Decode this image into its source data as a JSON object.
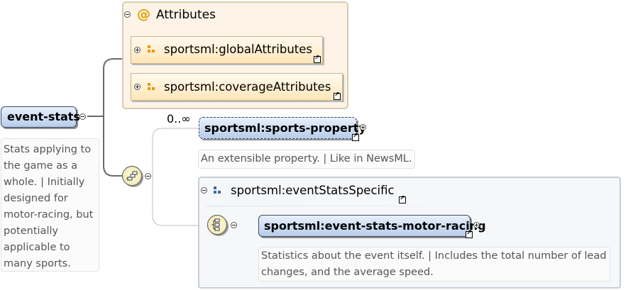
{
  "root": {
    "name": "event-stats",
    "doc": [
      "Stats applying to",
      "the game as a",
      "whole. | Initially",
      "designed for",
      "motor-racing, but",
      "potentially",
      "applicable to",
      "many sports."
    ]
  },
  "attributes": {
    "title": "Attributes",
    "at_symbol": "@",
    "groups": [
      {
        "label": "sportsml:globalAttributes"
      },
      {
        "label": "sportsml:coverageAttributes"
      }
    ]
  },
  "sports_property": {
    "cardinality": "0..∞",
    "name": "sportsml:sports-property",
    "doc": "An extensible property. | Like in NewsML."
  },
  "group_specific": {
    "title": "sportsml:eventStatsSpecific",
    "element": "sportsml:event-stats-motor-racing",
    "doc": [
      "Statistics about the event itself. | Includes the total number of lead",
      "changes, and the average speed."
    ]
  }
}
